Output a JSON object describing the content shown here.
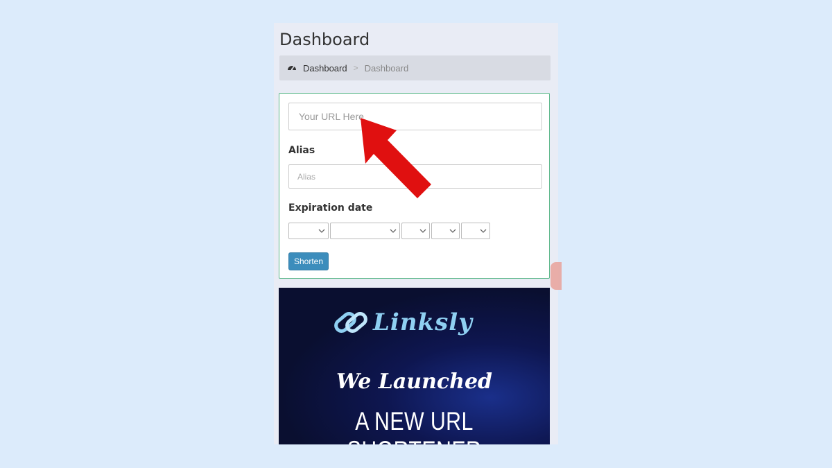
{
  "header": {
    "title": "Dashboard"
  },
  "breadcrumb": {
    "icon": "dashboard-gauge-icon",
    "home": "Dashboard",
    "separator": ">",
    "current": "Dashboard"
  },
  "form": {
    "url_placeholder": "Your URL Here",
    "alias_label": "Alias",
    "alias_placeholder": "Alias",
    "expiration_label": "Expiration date",
    "shorten_label": "Shorten"
  },
  "banner": {
    "logo_text": "Linksly",
    "headline": "We Launched",
    "subheadline": "A NEW URL SHORTENER",
    "background_color": "#0e1650",
    "logo_color": "#8fd0f2"
  },
  "annotation": {
    "arrow_color": "#e01010",
    "arrow_icon": "red-pointer-arrow-icon"
  },
  "colors": {
    "accent": "#3c8dbc",
    "form_border": "#5cb88a",
    "page_bg": "#dcebfb"
  }
}
